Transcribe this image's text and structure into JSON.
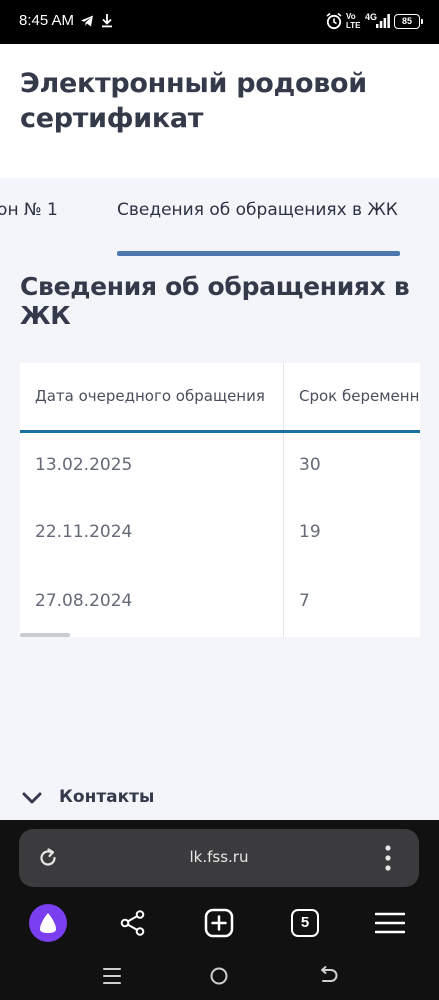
{
  "status_bar": {
    "time": "8:45 AM",
    "volte": "Vo\nLTE",
    "network": "4G",
    "battery": "85"
  },
  "header": {
    "title": "Электронный родовой сертификат"
  },
  "tabs": [
    {
      "label": "ион № 1",
      "active": false
    },
    {
      "label": "Сведения об обращениях в ЖК",
      "active": true
    }
  ],
  "section": {
    "title": "Сведения об обращениях в ЖК"
  },
  "table": {
    "columns": [
      "Дата очередного обращения",
      "Срок беременн"
    ],
    "rows": [
      {
        "date": "13.02.2025",
        "term": "30"
      },
      {
        "date": "22.11.2024",
        "term": "19"
      },
      {
        "date": "27.08.2024",
        "term": "7"
      }
    ]
  },
  "contacts": {
    "label": "Контакты"
  },
  "browser": {
    "url": "lk.fss.ru",
    "tabs_count": "5"
  },
  "colors": {
    "accent": "#4d78ad",
    "table_header_line": "#1a6fa3",
    "title_text": "#353a4a",
    "page_bg": "#f3f5fa",
    "alice_purple": "#7b3ff2"
  }
}
